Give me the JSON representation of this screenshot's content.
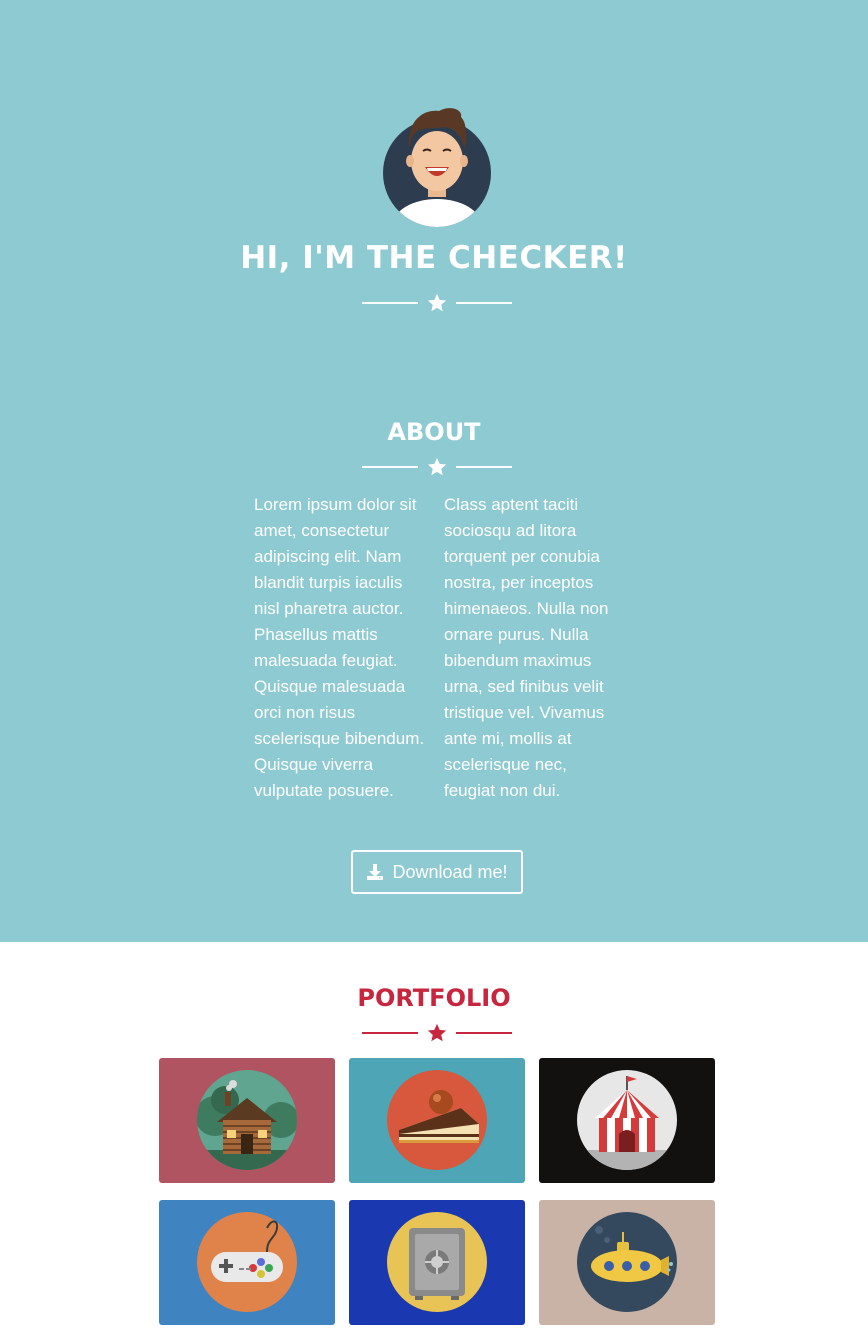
{
  "hero": {
    "title": "HI, I'M THE CHECKER!"
  },
  "about": {
    "title": "ABOUT",
    "column_1": "Lorem ipsum dolor sit amet, consectetur adipiscing elit. Nam blandit turpis iaculis nisl pharetra auctor. Phasellus mattis malesuada feugiat. Quisque malesuada orci non risus scelerisque bibendum. Quisque viverra vulputate posuere.",
    "column_2": "Class aptent taciti sociosqu ad litora torquent per conubia nostra, per inceptos himenaeos. Nulla non ornare purus. Nulla bibendum maximus urna, sed finibus velit tristique vel. Vivamus ante mi, mollis at scelerisque nec, feugiat non dui.",
    "download_label": "Download me!"
  },
  "portfolio": {
    "title": "PORTFOLIO",
    "items": [
      {
        "icon": "cabin-icon",
        "bg": "#b05462"
      },
      {
        "icon": "cake-icon",
        "bg": "#4ea5b6"
      },
      {
        "icon": "circus-tent-icon",
        "bg": "#121110"
      },
      {
        "icon": "game-controller-icon",
        "bg": "#3f83c1"
      },
      {
        "icon": "safe-icon",
        "bg": "#1a38b0"
      },
      {
        "icon": "submarine-icon",
        "bg": "#c8b3a6"
      }
    ]
  },
  "colors": {
    "hero_bg": "#8ecad1",
    "accent": "#c7263e",
    "white": "#ffffff"
  }
}
